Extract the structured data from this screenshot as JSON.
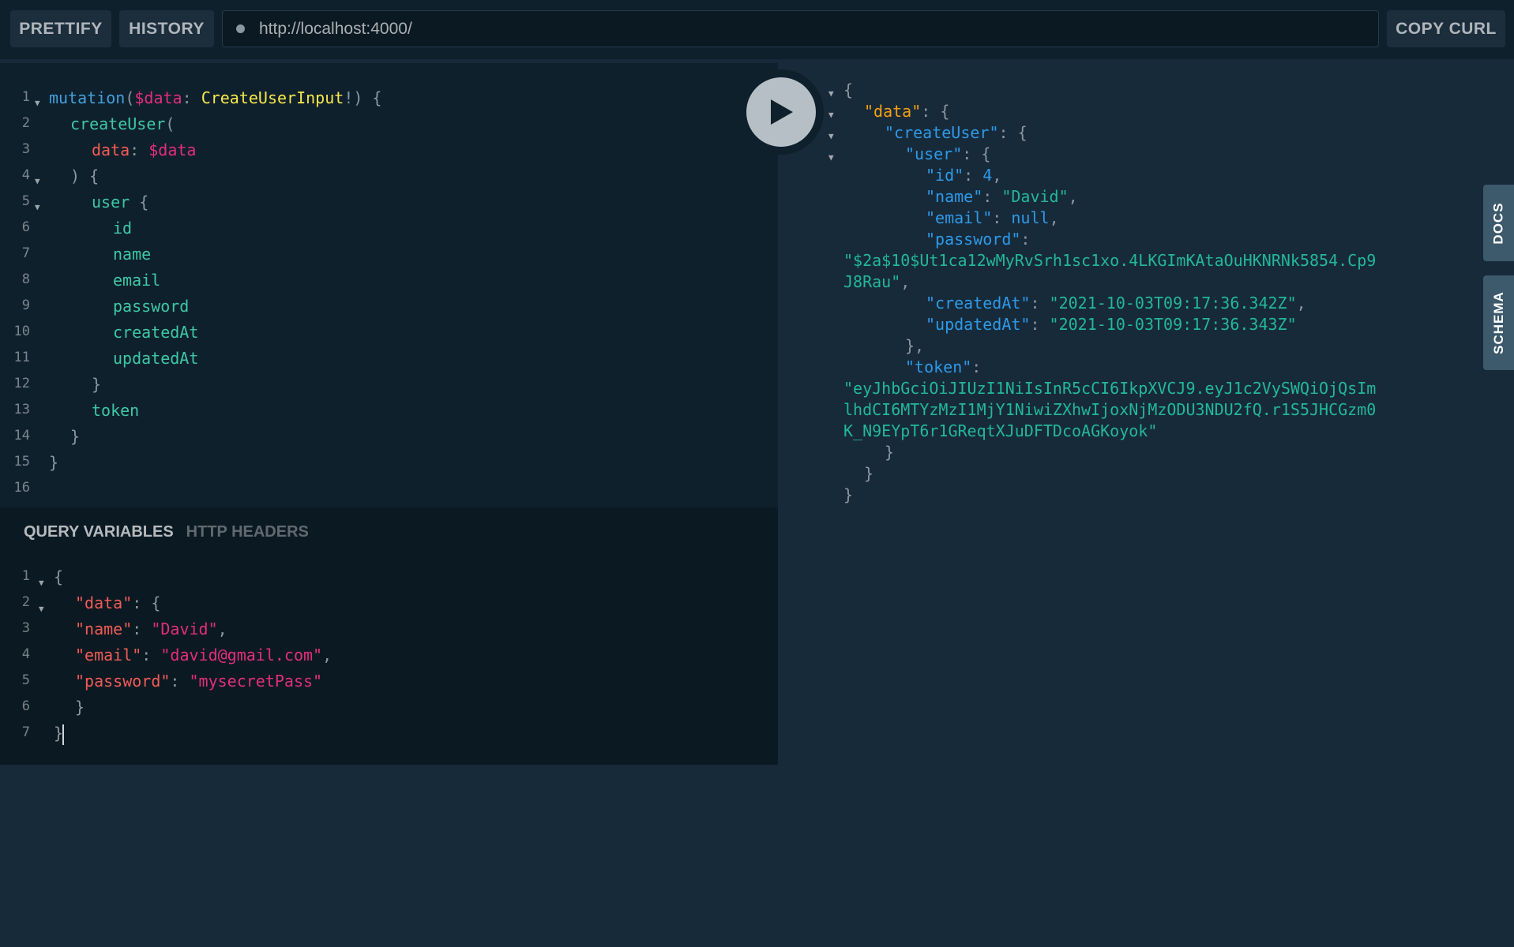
{
  "toolbar": {
    "prettify_label": "PRETTIFY",
    "history_label": "HISTORY",
    "url": "http://localhost:4000/",
    "copy_curl_label": "COPY CURL"
  },
  "side_tabs": {
    "docs": "DOCS",
    "schema": "SCHEMA"
  },
  "query_editor": {
    "line_numbers": [
      "1",
      "2",
      "3",
      "4",
      "5",
      "6",
      "7",
      "8",
      "9",
      "10",
      "11",
      "12",
      "13",
      "14",
      "15",
      "16"
    ],
    "l1": {
      "kw": "mutation",
      "p1": "(",
      "var": "$data",
      "p2": ": ",
      "type": "CreateUserInput",
      "p3": "!) {"
    },
    "l2": {
      "field": "createUser",
      "p": "("
    },
    "l3": {
      "arg": "data",
      "p": ": ",
      "var": "$data"
    },
    "l4": ") {",
    "l5": {
      "field": "user",
      "p": " {"
    },
    "fields": [
      "id",
      "name",
      "email",
      "password",
      "createdAt",
      "updatedAt"
    ],
    "l12": "}",
    "l13": "token",
    "l14": "}",
    "l15": "}"
  },
  "variables_panel": {
    "tab_active": "QUERY VARIABLES",
    "tab_inactive": "HTTP HEADERS",
    "line_numbers": [
      "1",
      "2",
      "3",
      "4",
      "5",
      "6",
      "7"
    ],
    "l1": "{",
    "l2": {
      "key": "\"data\"",
      "p": ": {"
    },
    "l3": {
      "key": "\"name\"",
      "p": ": ",
      "val": "\"David\"",
      "c": ","
    },
    "l4": {
      "key": "\"email\"",
      "p": ": ",
      "val": "\"david@gmail.com\"",
      "c": ","
    },
    "l5": {
      "key": "\"password\"",
      "p": ": ",
      "val": "\"mysecretPass\""
    },
    "l6": "}",
    "l7": "}"
  },
  "result": {
    "open": "{",
    "data_key": "\"data\"",
    "createUser_key": "\"createUser\"",
    "user_key": "\"user\"",
    "id_key": "\"id\"",
    "id_val": "4",
    "name_key": "\"name\"",
    "name_val": "\"David\"",
    "email_key": "\"email\"",
    "email_val": "null",
    "password_key": "\"password\"",
    "password_val_1": "\"$2a$10$Ut1ca12wMyRvSrh1sc1xo.4LKGImKAtaOuHKNRNk5854.Cp9",
    "password_val_2": "J8Rau\"",
    "createdAt_key": "\"createdAt\"",
    "createdAt_val": "\"2021-10-03T09:17:36.342Z\"",
    "updatedAt_key": "\"updatedAt\"",
    "updatedAt_val": "\"2021-10-03T09:17:36.343Z\"",
    "user_close": "},",
    "token_key": "\"token\"",
    "token_val_1": "\"eyJhbGciOiJIUzI1NiIsInR5cCI6IkpXVCJ9.eyJ1c2VySWQiOjQsIm",
    "token_val_2": "lhdCI6MTYzMzI1MjY1NiwiZXhwIjoxNjMzODU3NDU2fQ.r1S5JHCGzm0",
    "token_val_3": "K_N9EYpT6r1GReqtXJuDFTDcoAGKoyok\"",
    "close1": "}",
    "close2": "}",
    "close3": "}"
  },
  "icons": {
    "play": "play-icon",
    "status_dot": "status-dot-icon",
    "fold": "fold-arrow-icon"
  },
  "colors": {
    "background": "#172a3a",
    "panel": "#0f202d",
    "accent": "#3ec8a4"
  }
}
